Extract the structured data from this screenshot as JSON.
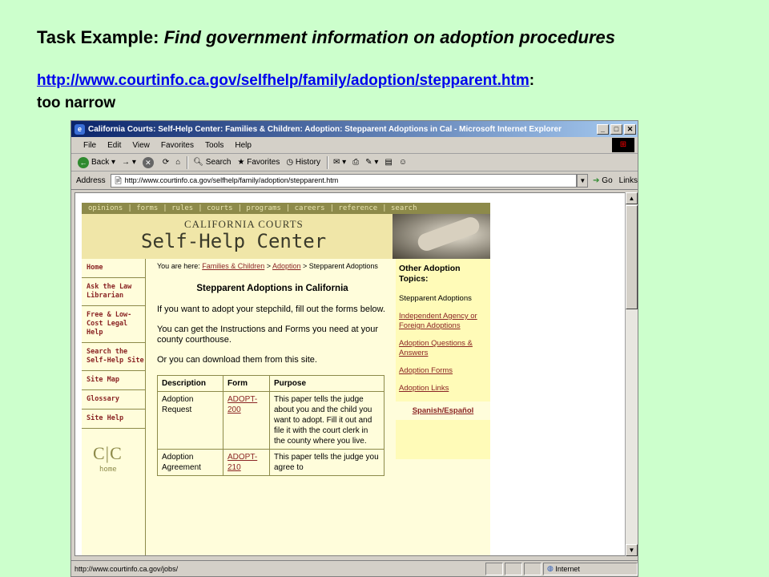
{
  "slide": {
    "title_prefix": "Task Example: ",
    "title_italic": "Find government information on adoption procedures",
    "link": "http://www.courtinfo.ca.gov/selfhelp/family/adoption/stepparent.htm",
    "link_suffix": ":",
    "note": "too narrow"
  },
  "browser": {
    "title": "California Courts: Self-Help Center: Families & Children: Adoption: Stepparent Adoptions in Cal - Microsoft Internet Explorer",
    "menu": [
      "File",
      "Edit",
      "View",
      "Favorites",
      "Tools",
      "Help"
    ],
    "toolbar": {
      "back": "Back",
      "search": "Search",
      "favorites": "Favorites",
      "history": "History"
    },
    "address_label": "Address",
    "address_value": "http://www.courtinfo.ca.gov/selfhelp/family/adoption/stepparent.htm",
    "go_label": "Go",
    "links_label": "Links",
    "status_text": "http://www.courtinfo.ca.gov/jobs/",
    "zone": "Internet"
  },
  "site": {
    "topnav": [
      "opinions",
      "| forms",
      "| rules",
      "| courts",
      "| programs",
      "| careers",
      "| reference",
      "| search"
    ],
    "banner_top": "CALIFORNIA COURTS",
    "banner_main": "Self-Help Center",
    "left_nav": [
      "Home",
      "Ask the Law Librarian",
      "Free & Low-Cost Legal Help",
      "Search the Self-Help Site",
      "Site Map",
      "Glossary",
      "Site Help"
    ],
    "logo": "C|C",
    "logo_caption": "home",
    "breadcrumb": {
      "prefix": "You are here: ",
      "crumb1": "Families & Children",
      "sep": " > ",
      "crumb2": "Adoption",
      "current": " > Stepparent Adoptions"
    },
    "heading": "Stepparent Adoptions in California",
    "paragraphs": [
      "If you want to adopt your stepchild, fill out the forms below.",
      "You can get the Instructions and Forms you need at your county courthouse.",
      "Or you can download them from this site."
    ],
    "table": {
      "headers": [
        "Description",
        "Form",
        "Purpose"
      ],
      "rows": [
        {
          "description": "Adoption Request",
          "form": "ADOPT-200",
          "purpose": "This paper tells the judge about you and the child you want to adopt. Fill it out and file it with the court clerk in the county where you live."
        },
        {
          "description": "Adoption Agreement",
          "form": "ADOPT-210",
          "purpose": "This paper tells the judge you agree to"
        }
      ]
    },
    "other_topics": {
      "title": "Other Adoption Topics:",
      "current": "Stepparent Adoptions",
      "links": [
        "Independent Agency or Foreign Adoptions",
        "Adoption Questions & Answers",
        "Adoption Forms",
        "Adoption Links"
      ],
      "spanish": "Spanish/Español"
    }
  }
}
